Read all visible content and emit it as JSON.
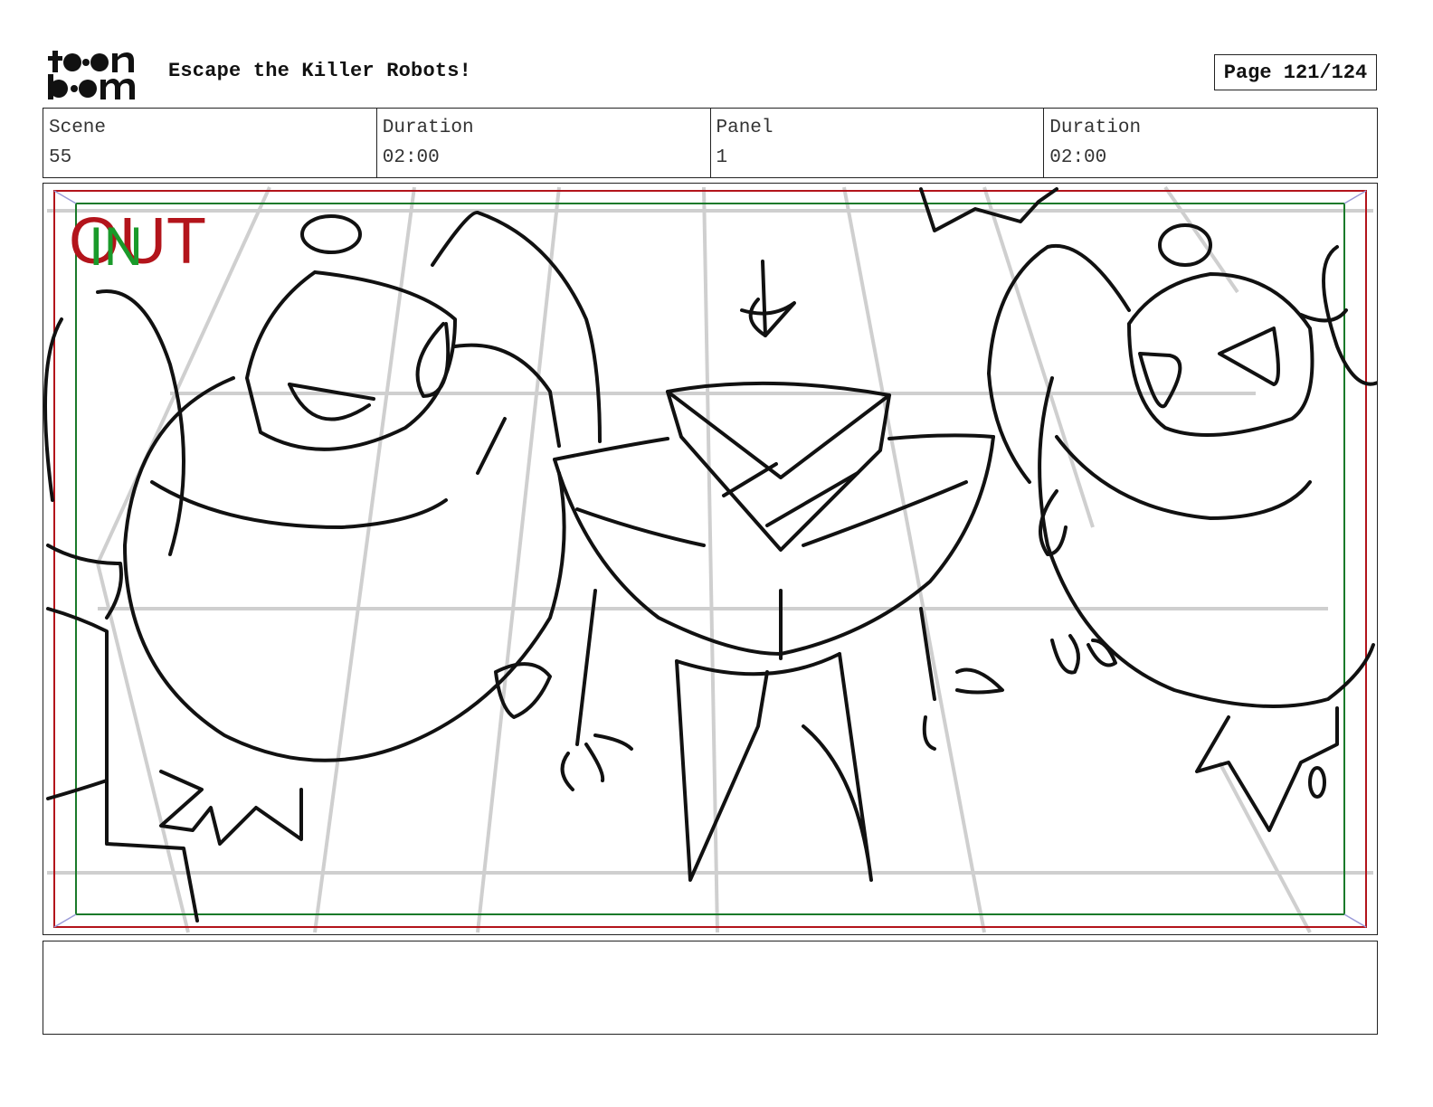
{
  "header": {
    "logo_text": "toon boom",
    "title": "Escape the Killer Robots!",
    "page_label": "Page 121/124"
  },
  "info": {
    "scene_label": "Scene",
    "scene_value": "55",
    "scene_duration_label": "Duration",
    "scene_duration_value": "02:00",
    "panel_label": "Panel",
    "panel_value": "1",
    "panel_duration_label": "Duration",
    "panel_duration_value": "02:00"
  },
  "panel": {
    "safe_frame_out_label": "OUT",
    "safe_frame_in_label": "IN",
    "colors": {
      "out_frame": "#b3141b",
      "in_frame": "#1a7a2a",
      "grid": "#cfcfcf",
      "ink": "#111111"
    }
  },
  "notes": {
    "text": ""
  }
}
